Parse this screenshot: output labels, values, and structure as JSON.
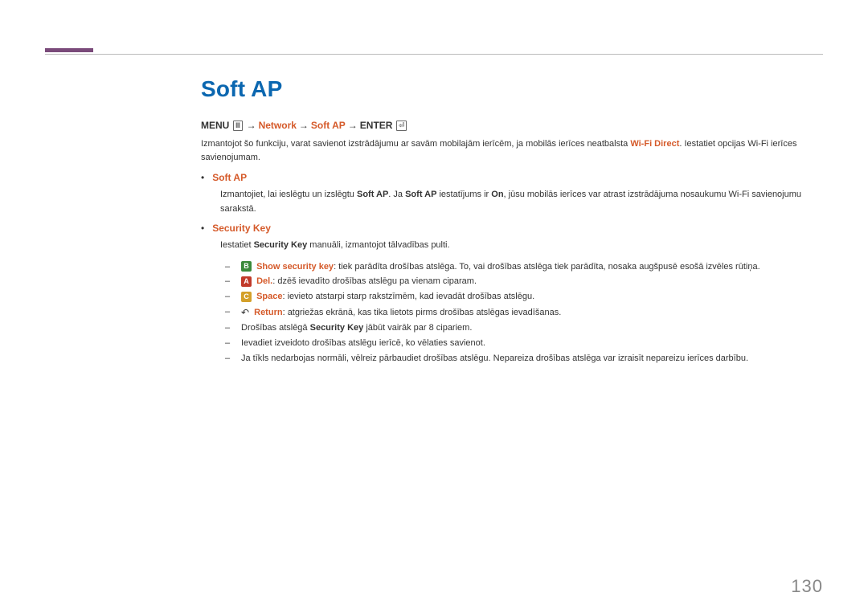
{
  "title": "Soft AP",
  "breadcrumb": {
    "menu": "MENU",
    "menu_icon": "Ⅲ",
    "arrow": "→",
    "nav1": "Network",
    "nav2": "Soft AP",
    "enter": "ENTER",
    "enter_icon": "⏎"
  },
  "intro": {
    "pre": "Izmantojot šo funkciju, varat savienot izstrādājumu ar savām mobilajām ierīcēm, ja mobilās ierīces neatbalsta ",
    "wifi_direct": "Wi-Fi Direct",
    "post": ". Iestatiet opcijas Wi-Fi ierīces savienojumam."
  },
  "b1": {
    "label": "Soft AP",
    "text_pre": "Izmantojiet, lai ieslēgtu un izslēgtu ",
    "softap1": "Soft AP",
    "mid1": ". Ja ",
    "softap2": "Soft AP",
    "mid2": " iestatījums ir ",
    "on": "On",
    "post": ", jūsu mobilās ierīces var atrast izstrādājuma nosaukumu Wi-Fi savienojumu sarakstā."
  },
  "b2": {
    "label": "Security Key",
    "intro_pre": "Iestatiet ",
    "sk": "Security Key",
    "intro_post": " manuāli, izmantojot tālvadības pulti."
  },
  "d1": {
    "key": "B",
    "label": "Show security key",
    "text": ": tiek parādīta drošības atslēga. To, vai drošības atslēga tiek parādīta, nosaka augšpusē esošā izvēles rūtiņa."
  },
  "d2": {
    "key": "A",
    "label": "Del.",
    "text": ": dzēš ievadīto drošības atslēgu pa vienam ciparam."
  },
  "d3": {
    "key": "C",
    "label": "Space",
    "text": ": ievieto atstarpi starp rakstzīmēm, kad ievadāt drošības atslēgu."
  },
  "d4": {
    "label": "Return",
    "text": ": atgriežas ekrānā, kas tika lietots pirms drošības atslēgas ievadīšanas."
  },
  "d5": {
    "pre": "Drošības atslēgā ",
    "sk": "Security Key",
    "post": " jābūt vairāk par 8 cipariem."
  },
  "d6": {
    "text": "Ievadiet izveidoto drošības atslēgu ierīcē, ko vēlaties savienot."
  },
  "d7": {
    "text": "Ja tīkls nedarbojas normāli, vēlreiz pārbaudiet drošības atslēgu. Nepareiza drošības atslēga var izraisīt nepareizu ierīces darbību."
  },
  "page_number": "130"
}
